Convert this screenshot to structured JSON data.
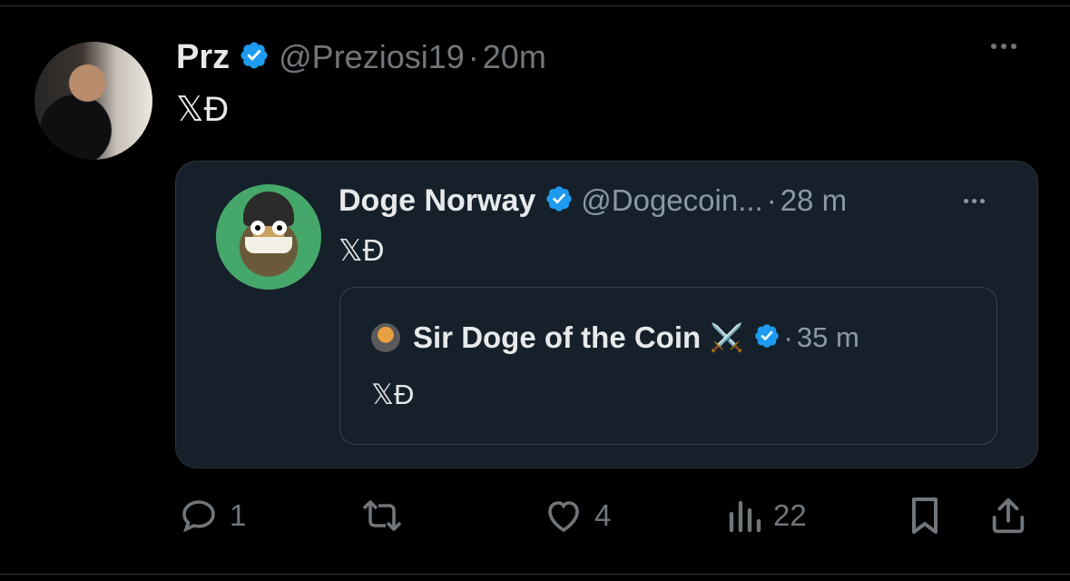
{
  "tweet": {
    "author_name": "Prz",
    "handle": "@Preziosi19",
    "separator": "·",
    "time": "20m",
    "text": "𝕏Đ"
  },
  "quote": {
    "author_name": "Doge Norway",
    "handle": "@Dogecoin...",
    "separator": "·",
    "time": "28 m",
    "text": "𝕏Đ"
  },
  "nested_quote": {
    "author_name": "Sir Doge of the Coin",
    "emoji": "⚔️",
    "separator": "·",
    "time": "35 m",
    "text": "𝕏Đ"
  },
  "actions": {
    "reply_count": "1",
    "retweet_count": "",
    "like_count": "4",
    "views_count": "22"
  },
  "colors": {
    "background": "#000000",
    "card": "#15202b",
    "verified": "#1d9bf0",
    "muted": "#71767b"
  },
  "icons": [
    "verified-badge-icon",
    "more-icon",
    "reply-icon",
    "retweet-icon",
    "like-icon",
    "views-icon",
    "bookmark-icon",
    "share-icon"
  ]
}
